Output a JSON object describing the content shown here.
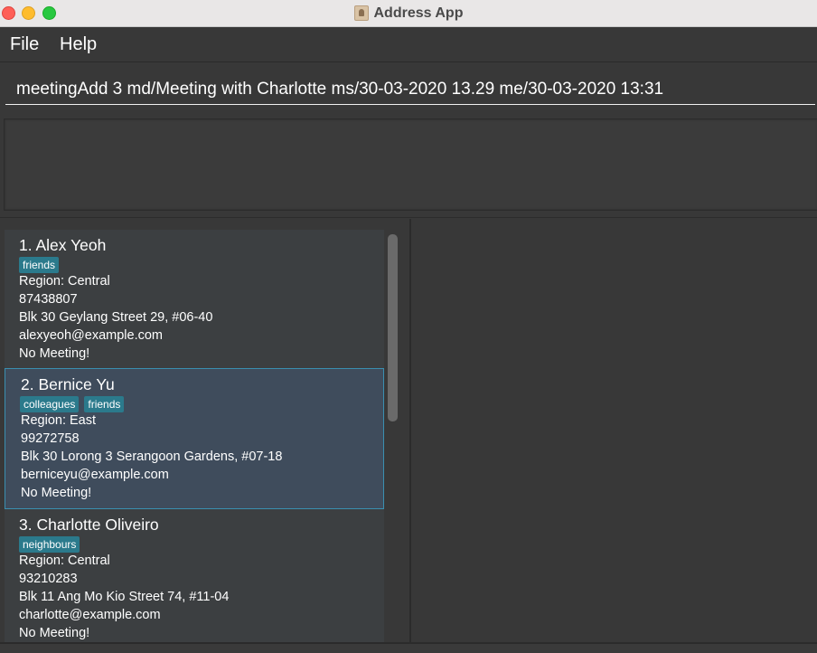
{
  "window": {
    "title": "Address App",
    "app_icon": "address-book-icon"
  },
  "menu": {
    "file": "File",
    "help": "Help"
  },
  "command": {
    "value": "meetingAdd 3 md/Meeting with Charlotte ms/30-03-2020 13.29 me/30-03-2020 13:31"
  },
  "result": {
    "text": ""
  },
  "persons": [
    {
      "name": "1.  Alex Yeoh",
      "tags": [
        "friends"
      ],
      "region": "Region: Central",
      "phone": "87438807",
      "address": "Blk 30 Geylang Street 29, #06-40",
      "email": "alexyeoh@example.com",
      "meeting": "No Meeting!"
    },
    {
      "name": "2.  Bernice Yu",
      "tags": [
        "colleagues",
        "friends"
      ],
      "region": "Region: East",
      "phone": "99272758",
      "address": "Blk 30 Lorong 3 Serangoon Gardens, #07-18",
      "email": "berniceyu@example.com",
      "meeting": "No Meeting!"
    },
    {
      "name": "3.  Charlotte Oliveiro",
      "tags": [
        "neighbours"
      ],
      "region": "Region: Central",
      "phone": "93210283",
      "address": "Blk 11 Ang Mo Kio Street 74, #11-04",
      "email": "charlotte@example.com",
      "meeting": "No Meeting!"
    }
  ],
  "colors": {
    "background": "#383838",
    "tag": "#2b7a8c",
    "selected_card": "#3f4c5c",
    "selected_border": "#3a8fb0"
  }
}
